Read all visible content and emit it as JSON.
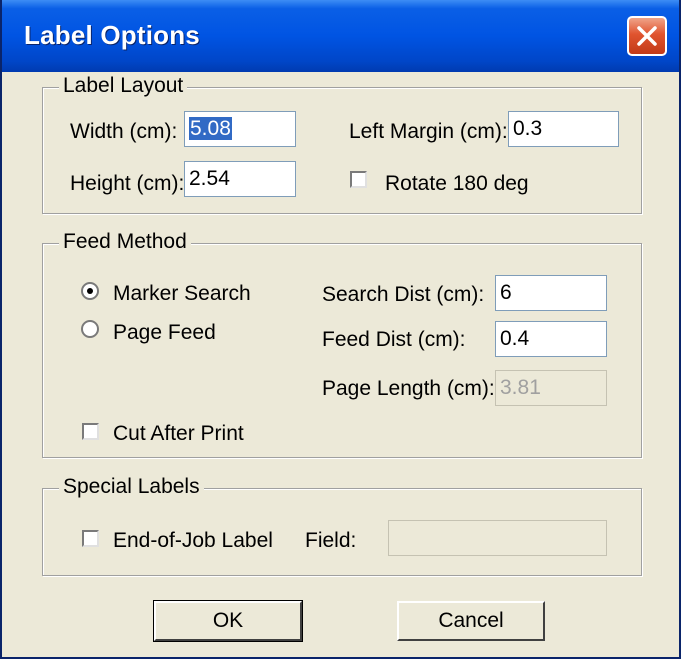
{
  "window": {
    "title": "Label Options"
  },
  "label_layout": {
    "legend": "Label Layout",
    "width_label": "Width (cm):",
    "width_value": "5.08",
    "height_label": "Height (cm):",
    "height_value": "2.54",
    "left_margin_label": "Left Margin (cm):",
    "left_margin_value": "0.3",
    "rotate_label": "Rotate 180 deg",
    "rotate_checked": false
  },
  "feed_method": {
    "legend": "Feed Method",
    "marker_search_label": "Marker Search",
    "marker_search_selected": true,
    "page_feed_label": "Page Feed",
    "page_feed_selected": false,
    "search_dist_label": "Search Dist (cm):",
    "search_dist_value": "6",
    "feed_dist_label": "Feed Dist (cm):",
    "feed_dist_value": "0.4",
    "page_length_label": "Page Length (cm):",
    "page_length_value": "3.81",
    "cut_after_print_label": "Cut After Print",
    "cut_after_print_checked": false
  },
  "special_labels": {
    "legend": "Special Labels",
    "end_of_job_label": "End-of-Job Label",
    "end_of_job_checked": false,
    "field_label": "Field:",
    "field_value": ""
  },
  "buttons": {
    "ok": "OK",
    "cancel": "Cancel"
  },
  "icons": {
    "close": "close-icon",
    "radio_dot": "radio-dot-icon"
  },
  "colors": {
    "titlebar": "#0054e3",
    "close_button": "#e0542f",
    "window_bg": "#ece9d8",
    "selection": "#316ac5"
  }
}
